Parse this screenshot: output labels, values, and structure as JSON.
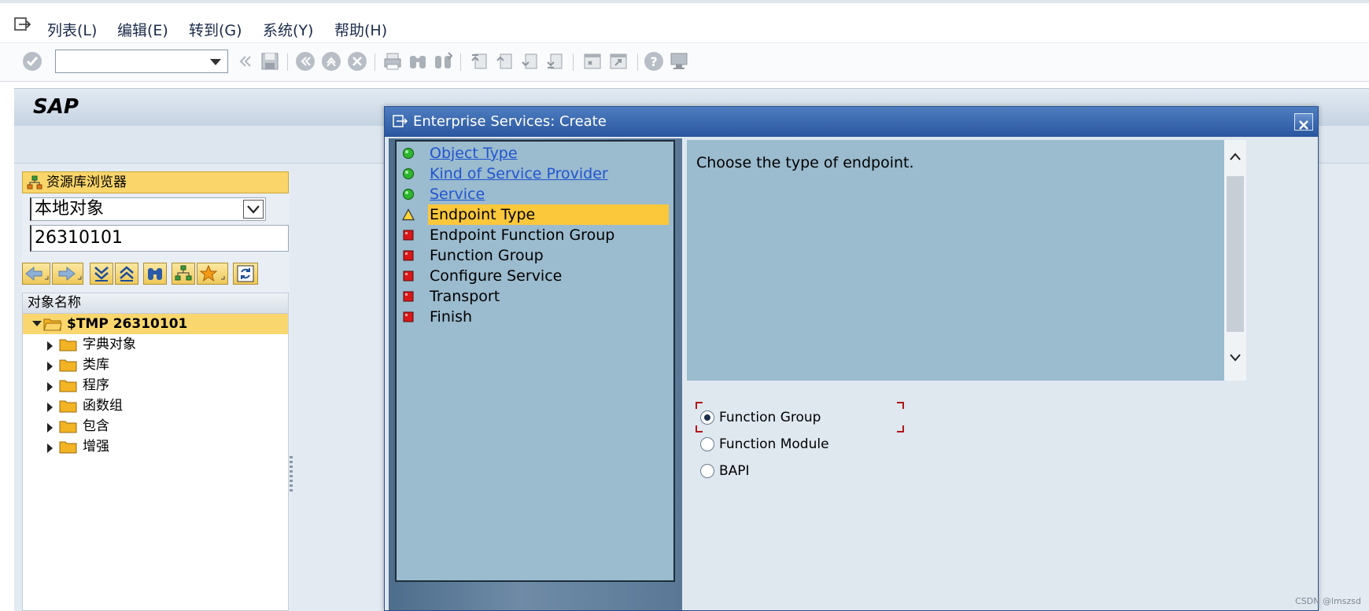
{
  "menubar": {
    "items": [
      {
        "label": "列表(L)"
      },
      {
        "label": "编辑(E)"
      },
      {
        "label": "转到(G)"
      },
      {
        "label": "系统(Y)"
      },
      {
        "label": "帮助(H)"
      }
    ]
  },
  "toolbar": {
    "command_field_value": ""
  },
  "screen": {
    "title": "SAP"
  },
  "repository_browser": {
    "header": "资源库浏览器",
    "object_type": "本地对象",
    "object_name": "26310101",
    "tree": {
      "column_header": "对象名称",
      "root": "$TMP 26310101",
      "children": [
        "字典对象",
        "类库",
        "程序",
        "函数组",
        "包含",
        "增强"
      ]
    }
  },
  "dialog": {
    "title": "Enterprise Services: Create",
    "steps": [
      {
        "label": "Object Type",
        "status": "done"
      },
      {
        "label": "Kind of Service Provider",
        "status": "done"
      },
      {
        "label": "Service",
        "status": "done"
      },
      {
        "label": "Endpoint Type",
        "status": "current"
      },
      {
        "label": "Endpoint Function Group",
        "status": "pending"
      },
      {
        "label": "Function Group",
        "status": "pending"
      },
      {
        "label": "Configure Service",
        "status": "pending"
      },
      {
        "label": "Transport",
        "status": "pending"
      },
      {
        "label": "Finish",
        "status": "pending"
      }
    ],
    "description": "Choose the type of endpoint.",
    "options": [
      {
        "label": "Function Group",
        "selected": true
      },
      {
        "label": "Function Module",
        "selected": false
      },
      {
        "label": "BAPI",
        "selected": false
      }
    ]
  },
  "watermark": "CSDN @lmszsd",
  "colors": {
    "dialog_title": "#2a56a0",
    "step_highlight": "#fbc73b",
    "link_blue": "#1f55d0",
    "panel_blue": "#9bbbce",
    "tree_selected": "#fad76e"
  }
}
